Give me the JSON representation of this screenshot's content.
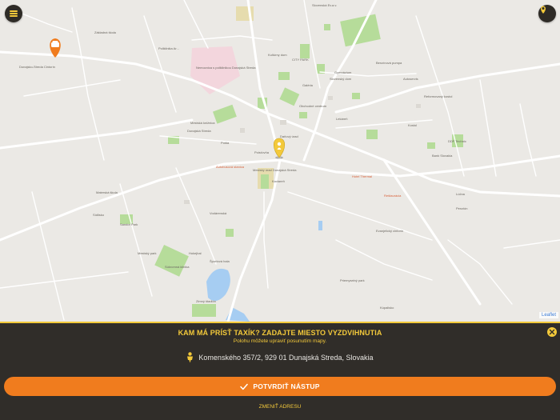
{
  "map": {
    "attribution": "Leaflet",
    "colors": {
      "background": "#ebe9e5",
      "road": "#ffffff",
      "park": "#a9d88c",
      "water": "#a6cdf2",
      "hospital": "#f3d6dd"
    },
    "labels": [
      "Slovenská Ev.a.v.",
      "Základná škola",
      "Poliklinika Ar...",
      "Kultúrny dom",
      "Slovenský dom",
      "Nemocnica s poliklinikou Dunajská Streda",
      "CITY PARK",
      "Galéria",
      "Obchodné centrum",
      "Poisťovňa",
      "Mestský úrad Dunajská Streda",
      "Dunajská Streda",
      "Mestská knižnica",
      "Vodárenská",
      "Autobusová stanica",
      "Daňový úrad",
      "Hotel Thermal",
      "Pošta",
      "Reštaurácia",
      "Lekáreň",
      "Materská škola",
      "Sandor Park",
      "Hokejbal",
      "Športová hala",
      "Kostol",
      "Reformovaný kostol",
      "Evanjelický cintorín",
      "Priemyselný park",
      "Dunajsko-Streda Cintorín",
      "Bank Slovakia",
      "Penzión",
      "Súkromná klinika",
      "Mestský park",
      "Kaviareň",
      "Zimný štadión",
      "Kúpalisko",
      "Sídlisko",
      "Autoservis",
      "Benzínová pumpa",
      "Gymnázium",
      "DDF Technic",
      "Lúčna"
    ],
    "taxi_marker_icon": "taxi-car-icon",
    "pickup_marker_icon": "map-pin-icon"
  },
  "controls": {
    "menu_icon": "hamburger-menu-icon",
    "location_icon": "location-pin-icon"
  },
  "panel": {
    "title": "KAM MÁ PRÍSŤ TAXÍK? ZADAJTE MIESTO VYZDVIHNUTIA",
    "subtitle": "Polohu môžete upraviť posunutím mapy.",
    "address": "Komenského 357/2, 929 01 Dunajská Streda, Slovakia",
    "confirm_label": "POTVRDIŤ NÁSTUP",
    "change_label": "ZMENIŤ ADRESU",
    "close_icon": "close-icon",
    "person_icon": "person-pin-icon",
    "check_icon": "checkmark-icon"
  },
  "theme": {
    "accent_yellow": "#f3c93a",
    "accent_orange": "#f07c1e",
    "panel_bg": "#302d29",
    "text_light": "#e8e6e2"
  }
}
